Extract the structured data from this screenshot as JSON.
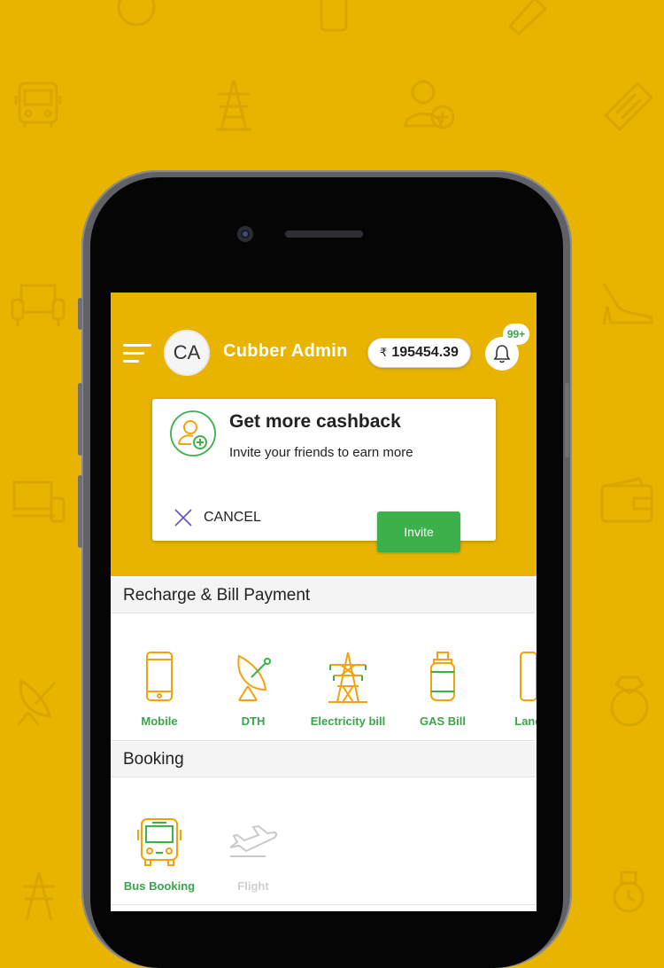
{
  "colors": {
    "brand_yellow": "#E8B400",
    "green": "#3bb04b",
    "icon_orange": "#F0A30A"
  },
  "header": {
    "avatar_initials": "CA",
    "user_name": "Cubber Admin",
    "currency_symbol": "₹",
    "balance": "195454.39",
    "notification_count": "99+"
  },
  "cashback": {
    "title": "Get more cashback",
    "subtitle": "Invite your friends to earn more",
    "cancel_label": "CANCEL",
    "invite_label": "Invite"
  },
  "recharge": {
    "section_title": "Recharge & Bill Payment",
    "items": [
      {
        "label": "Mobile",
        "icon": "mobile-icon"
      },
      {
        "label": "DTH",
        "icon": "satellite-dish-icon"
      },
      {
        "label": "Electricity bill",
        "icon": "power-tower-icon"
      },
      {
        "label": "GAS Bill",
        "icon": "gas-cylinder-icon"
      },
      {
        "label": "Landline",
        "icon": "landline-icon"
      }
    ]
  },
  "booking": {
    "section_title": "Booking",
    "items": [
      {
        "label": "Bus Booking",
        "icon": "bus-icon"
      },
      {
        "label": "Flight",
        "icon": "airplane-icon"
      }
    ]
  }
}
